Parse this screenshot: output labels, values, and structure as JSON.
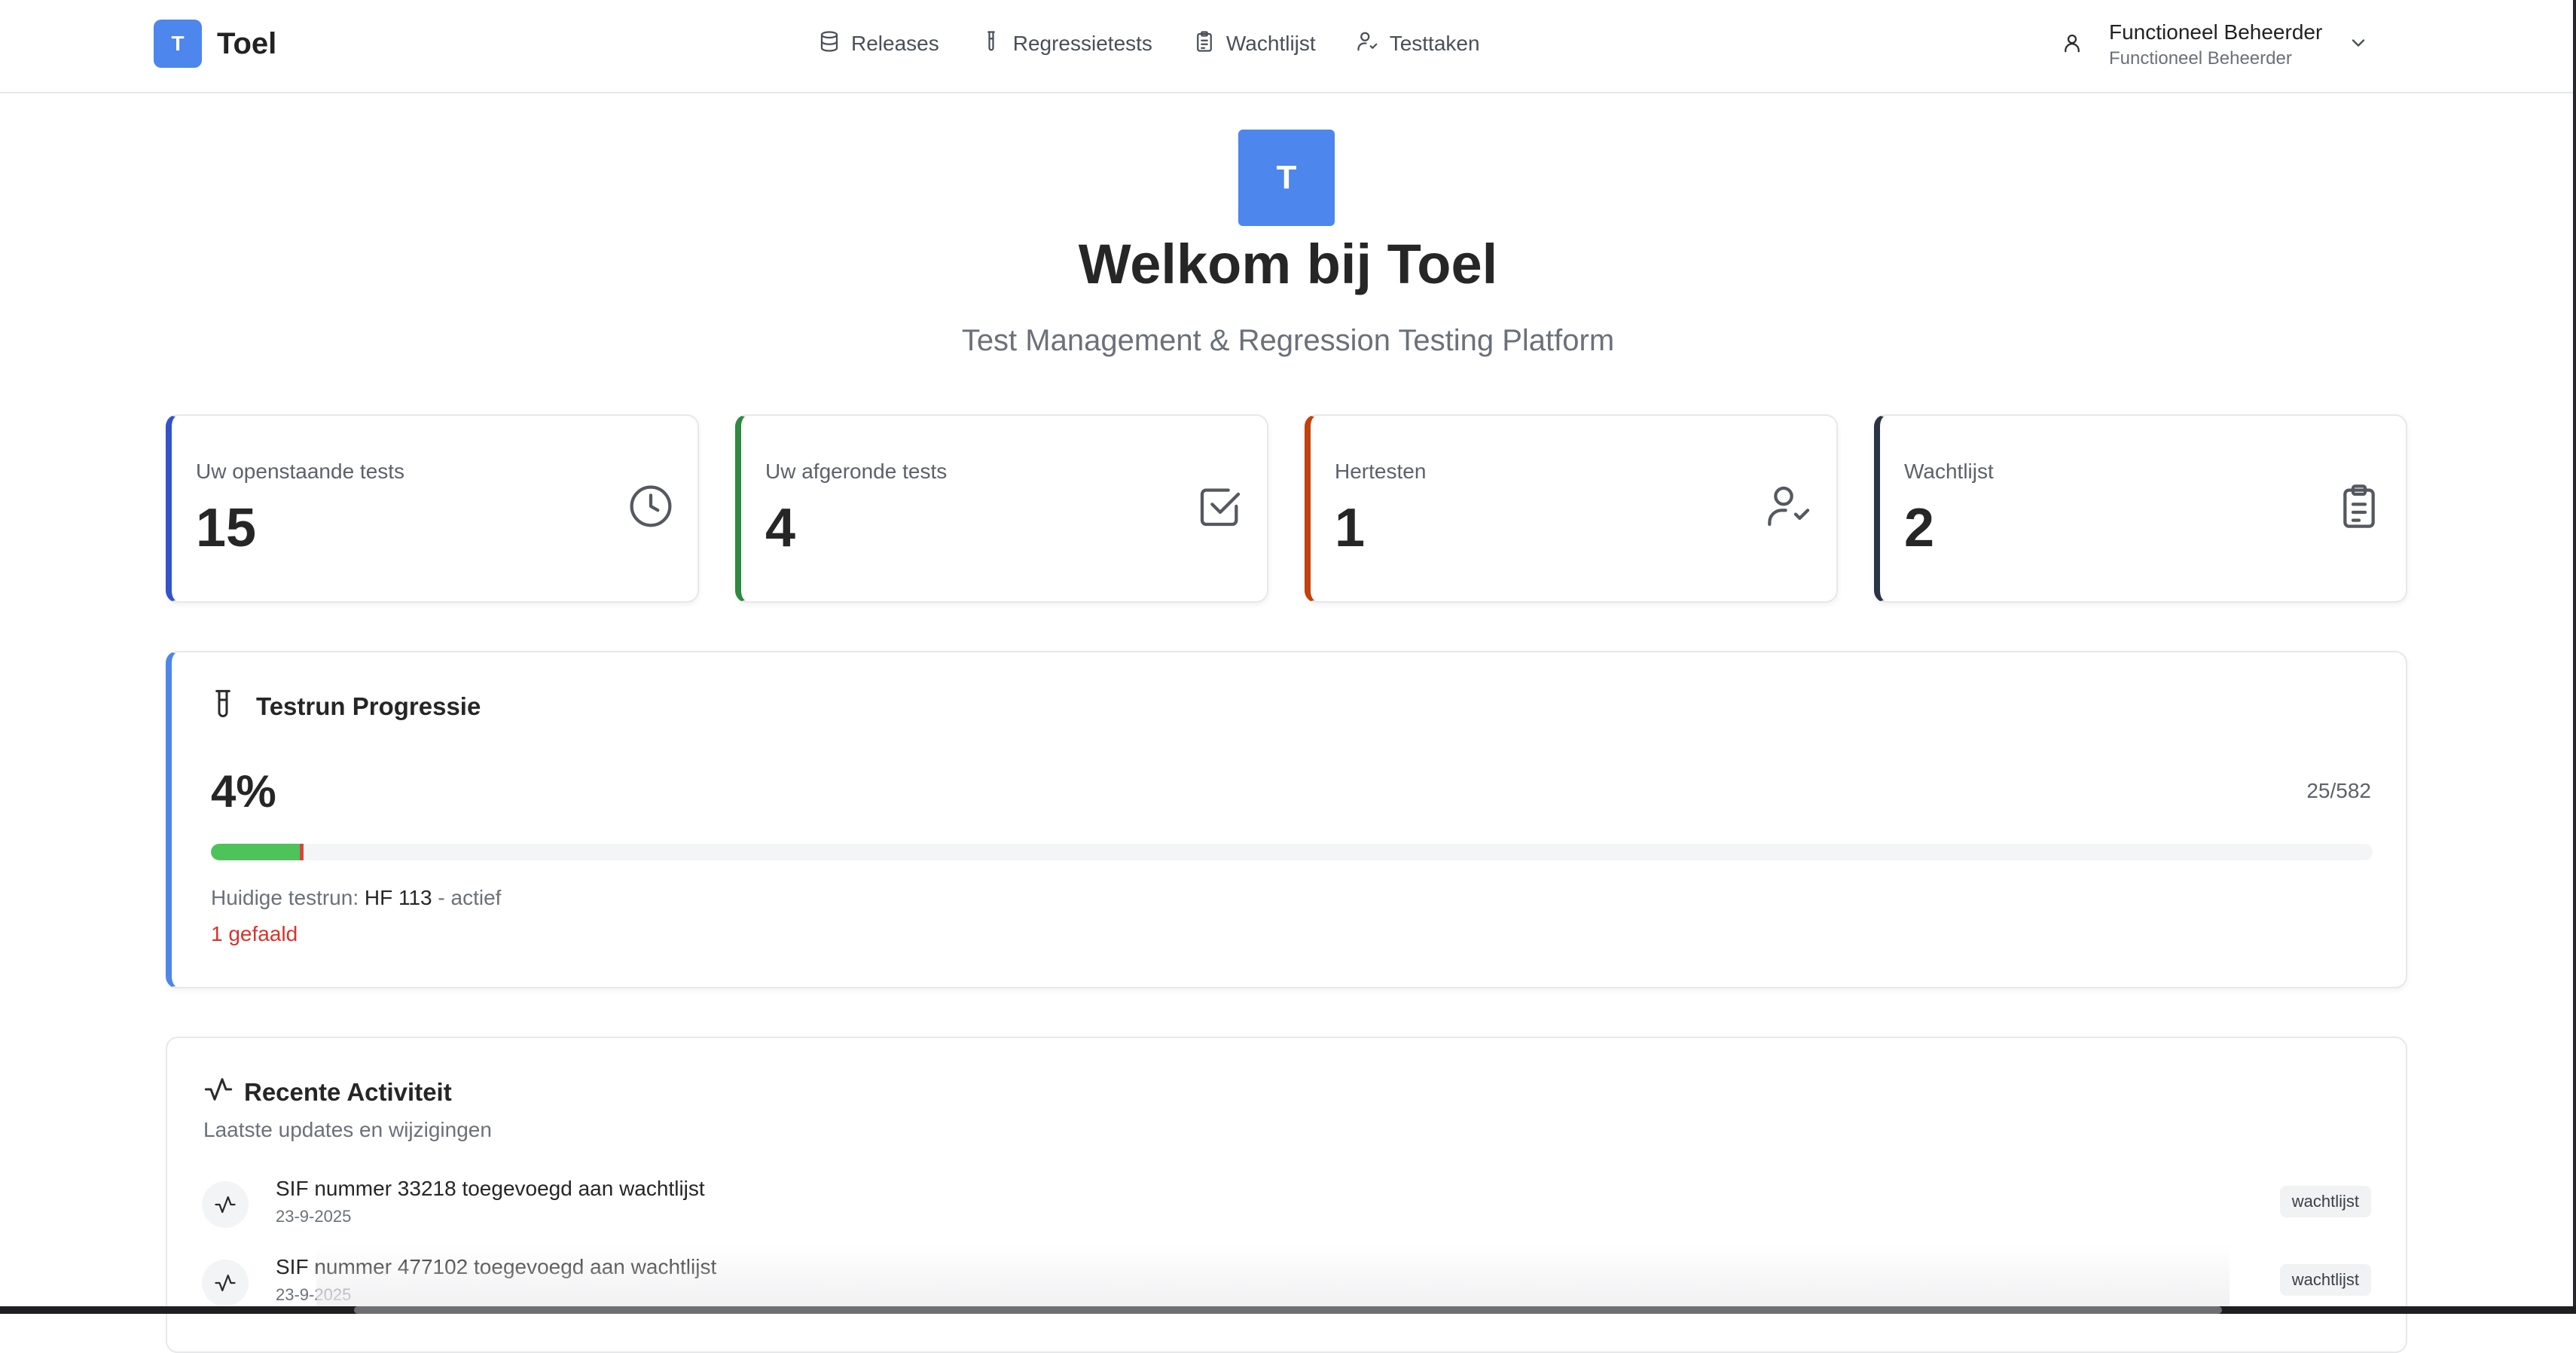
{
  "app": {
    "logo_letter": "T",
    "name": "Toel"
  },
  "nav": {
    "items": [
      {
        "label": "Releases",
        "icon": "database-icon"
      },
      {
        "label": "Regressietests",
        "icon": "test-tube-icon"
      },
      {
        "label": "Wachtlijst",
        "icon": "clipboard-list-icon"
      },
      {
        "label": "Testtaken",
        "icon": "user-check-icon"
      }
    ]
  },
  "user": {
    "name": "Functioneel Beheerder",
    "role": "Functioneel Beheerder",
    "icon": "user-icon"
  },
  "hero": {
    "logo_letter": "T",
    "title": "Welkom bij Toel",
    "subtitle": "Test Management & Regression Testing Platform"
  },
  "stats": [
    {
      "label": "Uw openstaande tests",
      "value": "15",
      "icon": "clock-icon",
      "color": "#3253c9"
    },
    {
      "label": "Uw afgeronde tests",
      "value": "4",
      "icon": "square-check-icon",
      "color": "#2f8a3f"
    },
    {
      "label": "Hertesten",
      "value": "1",
      "icon": "user-check-icon",
      "color": "#c2410c"
    },
    {
      "label": "Wachtlijst",
      "value": "2",
      "icon": "clipboard-list-icon",
      "color": "#2c3347"
    }
  ],
  "progress": {
    "title": "Testrun Progressie",
    "percent_label": "4%",
    "count_label": "25/582",
    "completed": 25,
    "failed": 1,
    "total": 582,
    "run_prefix": "Huidige testrun:",
    "run_name": "HF 113",
    "run_status": "- actief",
    "failed_label": "1 gefaald",
    "colors": {
      "pass": "#4ec35a",
      "fail": "#d8443b"
    }
  },
  "activity": {
    "title": "Recente Activiteit",
    "subtitle": "Laatste updates en wijzigingen",
    "items": [
      {
        "text": "SIF nummer 33218 toegevoegd aan wachtlijst",
        "date": "23-9-2025",
        "badge": "wachtlijst"
      },
      {
        "text": "SIF nummer 477102 toegevoegd aan wachtlijst",
        "date": "23-9-2025",
        "badge": "wachtlijst"
      }
    ]
  }
}
